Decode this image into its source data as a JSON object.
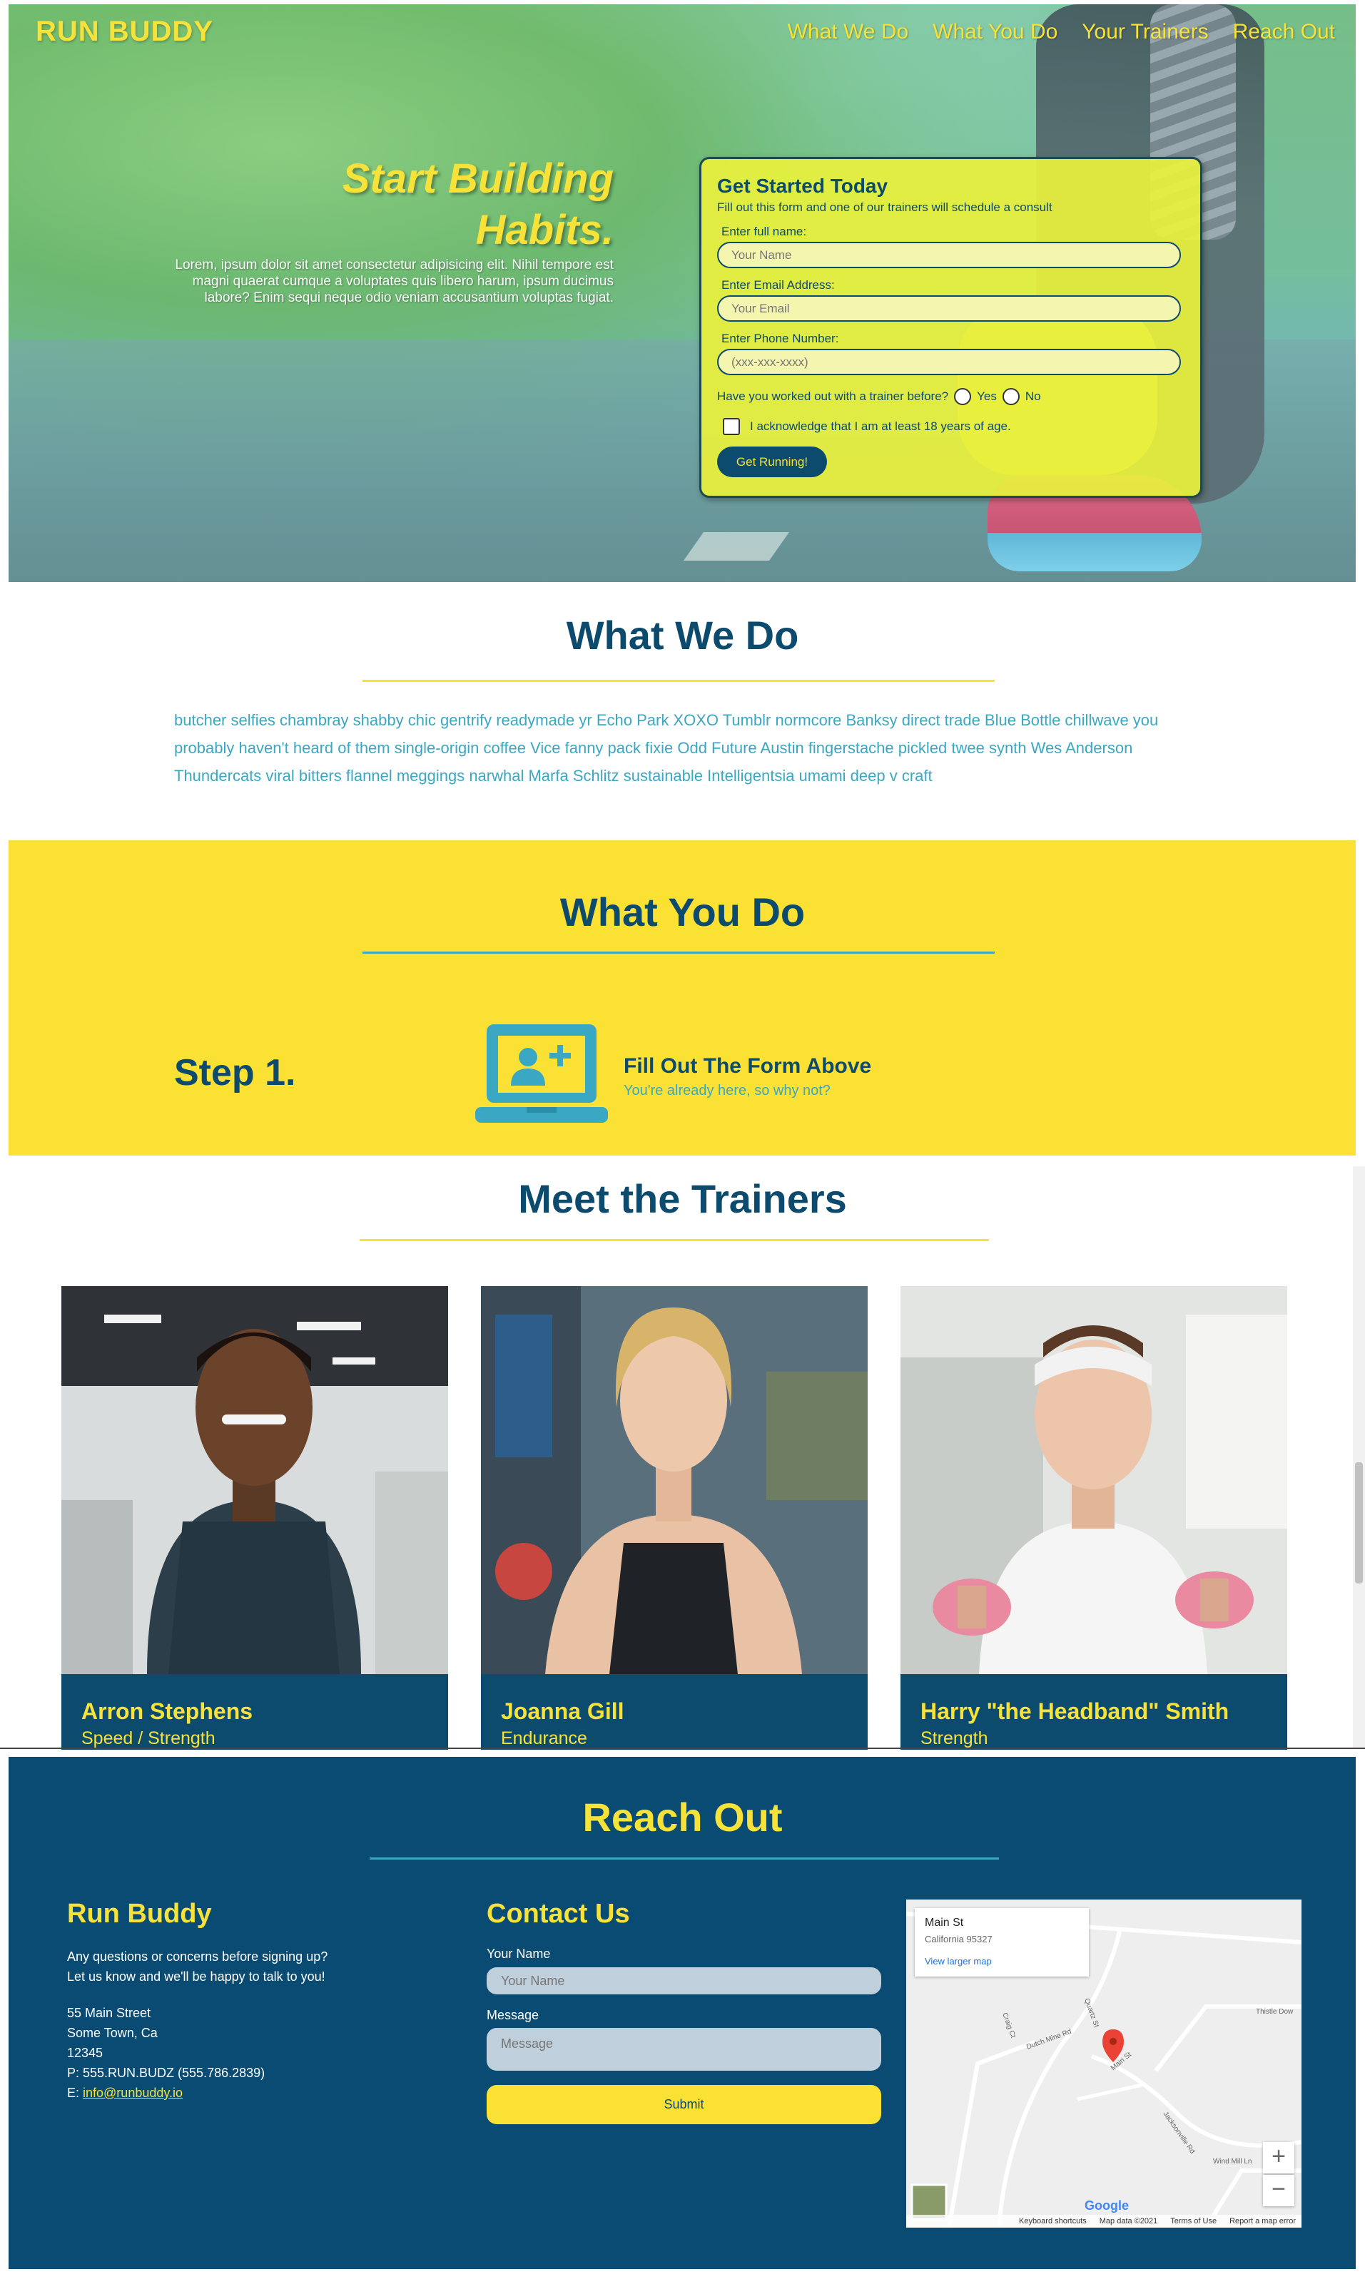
{
  "header": {
    "brand": "RUN BUDDY",
    "nav": [
      "What We Do",
      "What You Do",
      "Your Trainers",
      "Reach Out"
    ]
  },
  "hero": {
    "title_line1": "Start Building",
    "title_line2": "Habits.",
    "text": "Lorem, ipsum dolor sit amet consectetur adipisicing elit. Nihil tempore est magni quaerat cumque a voluptates quis libero harum, ipsum ducimus labore? Enim sequi neque odio veniam accusantium voluptas fugiat."
  },
  "signup_form": {
    "title": "Get Started Today",
    "subtitle": "Fill out this form and one of our trainers will schedule a consult",
    "name_label": "Enter full name:",
    "name_placeholder": "Your Name",
    "email_label": "Enter Email Address:",
    "email_placeholder": "Your Email",
    "phone_label": "Enter Phone Number:",
    "phone_placeholder": "(xxx-xxx-xxxx)",
    "trainer_question": "Have you worked out with a trainer before?",
    "yes_label": "Yes",
    "no_label": "No",
    "age_ack": "I acknowledge that I am at least 18 years of age.",
    "submit_label": "Get Running!"
  },
  "what_we_do": {
    "title": "What We Do",
    "text": "butcher selfies chambray shabby chic gentrify readymade yr Echo Park XOXO Tumblr normcore Banksy direct trade Blue Bottle chillwave you probably haven't heard of them single-origin coffee Vice fanny pack fixie Odd Future Austin fingerstache pickled twee synth Wes Anderson Thundercats viral bitters flannel meggings narwhal Marfa Schlitz sustainable Intelligentsia umami deep v craft"
  },
  "what_you_do": {
    "title": "What You Do",
    "step_label": "Step 1.",
    "step_title": "Fill Out The Form Above",
    "step_sub": "You're already here, so why not?",
    "step_icon": "laptop-add-user-icon"
  },
  "trainers": {
    "title": "Meet the Trainers",
    "items": [
      {
        "name": "Arron Stephens",
        "role": "Speed / Strength"
      },
      {
        "name": "Joanna Gill",
        "role": "Endurance"
      },
      {
        "name": "Harry \"the Headband\" Smith",
        "role": "Strength"
      }
    ]
  },
  "footer": {
    "title": "Reach Out",
    "about_title": "Run Buddy",
    "about_line1": "Any questions or concerns before signing up?",
    "about_line2": "Let us know and we'll be happy to talk to you!",
    "address1": "55 Main Street",
    "address2": "Some Town, Ca",
    "address3": "12345",
    "phone": "P: 555.RUN.BUDZ (555.786.2839)",
    "email_prefix": "E: ",
    "email": "info@runbuddy.io",
    "contact_title": "Contact Us",
    "name_label": "Your Name",
    "name_placeholder": "Your Name",
    "message_label": "Message",
    "message_placeholder": "Message",
    "submit_label": "Submit"
  },
  "map": {
    "place": "Main St",
    "region": "California 95327",
    "larger_map": "View larger map",
    "logo": "Google",
    "zoom_in": "+",
    "zoom_out": "−",
    "attribution": [
      "Keyboard shortcuts",
      "Map data ©2021",
      "Terms of Use",
      "Report a map error"
    ],
    "street_labels": [
      "Main St",
      "Dutch Mine Rd",
      "Thistle Dow",
      "Wind Mill Ln",
      "Jacksonville Rd",
      "Craig Ct",
      "Quartz St"
    ]
  },
  "colors": {
    "navy": "#0c4a6e",
    "yellow": "#f7e23a",
    "section_yellow": "#fae133",
    "teal": "#3aa7c3",
    "footer_bg": "#0a4b73"
  }
}
